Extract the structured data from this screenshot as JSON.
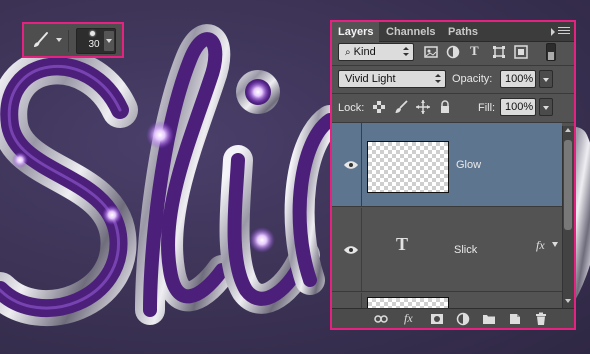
{
  "toolbar": {
    "brush_size": "30",
    "brush_icon": "paintbrush-icon"
  },
  "layers_panel": {
    "tabs": [
      {
        "label": "Layers"
      },
      {
        "label": "Channels"
      },
      {
        "label": "Paths"
      }
    ],
    "filter": {
      "label": "Kind"
    },
    "blend_mode": "Vivid Light",
    "opacity_label": "Opacity:",
    "opacity_value": "100%",
    "lock_label": "Lock:",
    "fill_label": "Fill:",
    "fill_value": "100%",
    "layers": [
      {
        "name": "Glow",
        "selected": true,
        "kind": "pixel"
      },
      {
        "name": "Slick",
        "selected": false,
        "kind": "type",
        "has_fx": true
      },
      {
        "name": "",
        "selected": false,
        "kind": "pixel"
      }
    ],
    "type_glyph": "T",
    "fx_glyph": "fx"
  },
  "colors": {
    "highlight": "#e5227f",
    "panel_bg": "#535353",
    "selected_row": "#5e7590",
    "canvas_bg": "#3b3254",
    "text_purple": "#5a2a8a"
  }
}
